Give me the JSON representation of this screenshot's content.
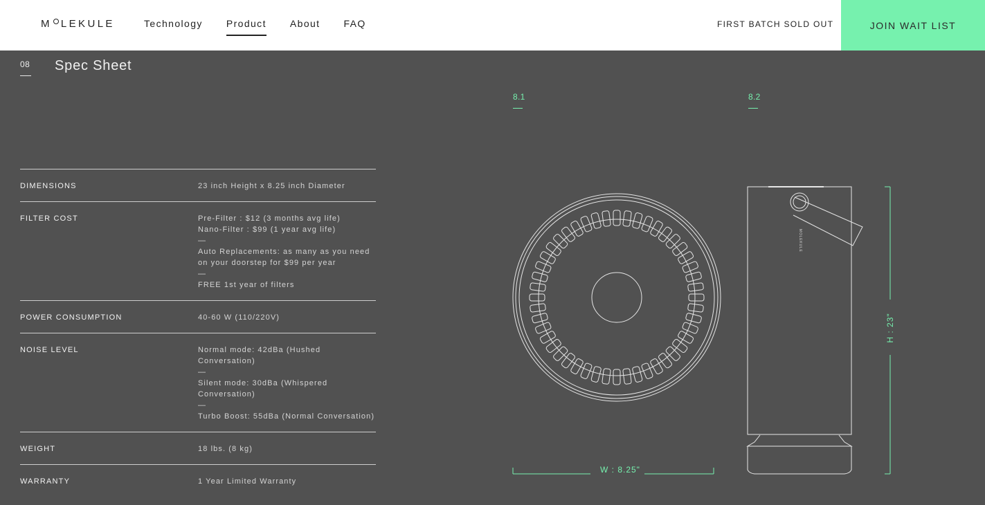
{
  "header": {
    "logo_left": "M",
    "logo_right": "LEKULE",
    "nav": [
      {
        "label": "Technology",
        "active": false
      },
      {
        "label": "Product",
        "active": true
      },
      {
        "label": "About",
        "active": false
      },
      {
        "label": "FAQ",
        "active": false
      }
    ],
    "status_text": "FIRST BATCH SOLD OUT",
    "cta_label": "JOIN WAIT LIST",
    "cta_color": "#76f1ae"
  },
  "section": {
    "number": "08",
    "title": "Spec Sheet"
  },
  "specs": [
    {
      "label": "DIMENSIONS",
      "lines": [
        "23 inch Height x 8.25 inch Diameter"
      ]
    },
    {
      "label": "FILTER COST",
      "lines": [
        "Pre-Filter : $12 (3 months avg life)",
        "Nano-Filter : $99 (1 year avg life)",
        "—",
        "Auto Replacements: as many as you need on your doorstep for $99 per year",
        "—",
        "FREE 1st year of filters"
      ]
    },
    {
      "label": "POWER CONSUMPTION",
      "lines": [
        "40-60 W (110/220V)"
      ]
    },
    {
      "label": "NOISE LEVEL",
      "lines": [
        "Normal mode: 42dBa (Hushed Conversation)",
        "—",
        "Silent mode: 30dBa (Whispered Conversation)",
        "—",
        "Turbo Boost: 55dBa (Normal Conversation)"
      ]
    },
    {
      "label": "WEIGHT",
      "lines": [
        "18 lbs. (8 kg)"
      ]
    },
    {
      "label": "WARRANTY",
      "lines": [
        "1 Year Limited Warranty"
      ]
    }
  ],
  "figures": {
    "top_view_number": "8.1",
    "side_view_number": "8.2",
    "width_label": "W : 8.25\"",
    "height_label": "H : 23\"",
    "device_text": "MOLEKULE",
    "accent_color": "#76f1ae"
  }
}
